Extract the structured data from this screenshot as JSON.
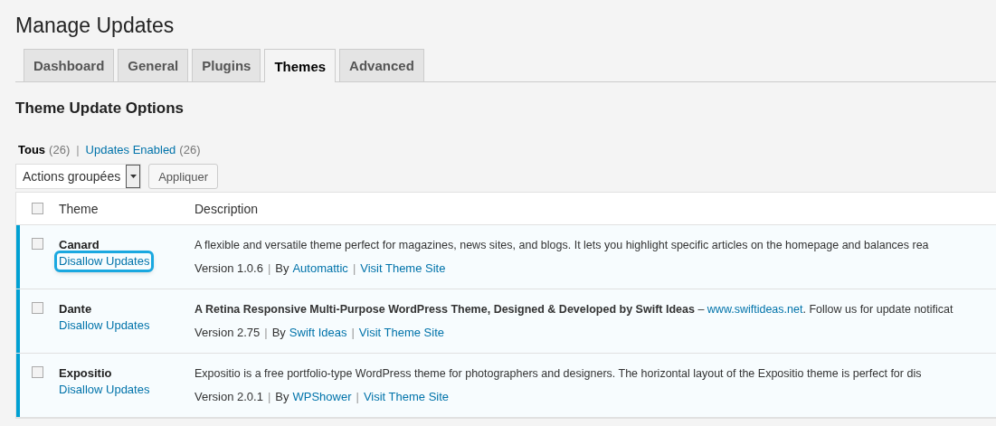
{
  "page_title": "Manage Updates",
  "tabs": [
    {
      "label": "Dashboard",
      "selected": false
    },
    {
      "label": "General",
      "selected": false
    },
    {
      "label": "Plugins",
      "selected": false
    },
    {
      "label": "Themes",
      "selected": true
    },
    {
      "label": "Advanced",
      "selected": false
    }
  ],
  "section_title": "Theme Update Options",
  "filters": [
    {
      "label": "Tous",
      "count": "(26)",
      "selected": true
    },
    {
      "label": "Updates Enabled",
      "count": "(26)",
      "selected": false
    }
  ],
  "filter_separator": "|",
  "bulk_actions": {
    "value": "Actions groupées",
    "button": "Appliquer"
  },
  "table": {
    "columns": [
      "Theme",
      "Description"
    ],
    "header_checked": false,
    "rows": [
      {
        "name": "Canard",
        "action": "Disallow Updates",
        "action_focused": true,
        "checked": false,
        "enabled": true,
        "description": "A flexible and versatile theme perfect for magazines, news sites, and blogs. It lets you highlight specific articles on the homepage and balances rea",
        "version": "Version 1.0.6",
        "by": "By",
        "author": "Automattic",
        "site_link": "Visit Theme Site"
      },
      {
        "name": "Dante",
        "action": "Disallow Updates",
        "action_focused": false,
        "checked": false,
        "enabled": true,
        "description": "**A Retina Responsive Multi-Purpose WordPress Theme, Designed & Developed by Swift Ideas** –",
        "description_link": "www.swiftideas.net",
        "description_after": ". Follow us for update notificat",
        "version": "Version 2.75",
        "by": "By",
        "author": "Swift Ideas",
        "site_link": "Visit Theme Site"
      },
      {
        "name": "Expositio",
        "action": "Disallow Updates",
        "action_focused": false,
        "checked": false,
        "enabled": true,
        "description": "Expositio is a free portfolio-type WordPress theme for photographers and designers. The horizontal layout of the Expositio theme is perfect for dis",
        "version": "Version 2.0.1",
        "by": "By",
        "author": "WPShower",
        "site_link": "Visit Theme Site"
      }
    ],
    "meta_separator": "|"
  }
}
